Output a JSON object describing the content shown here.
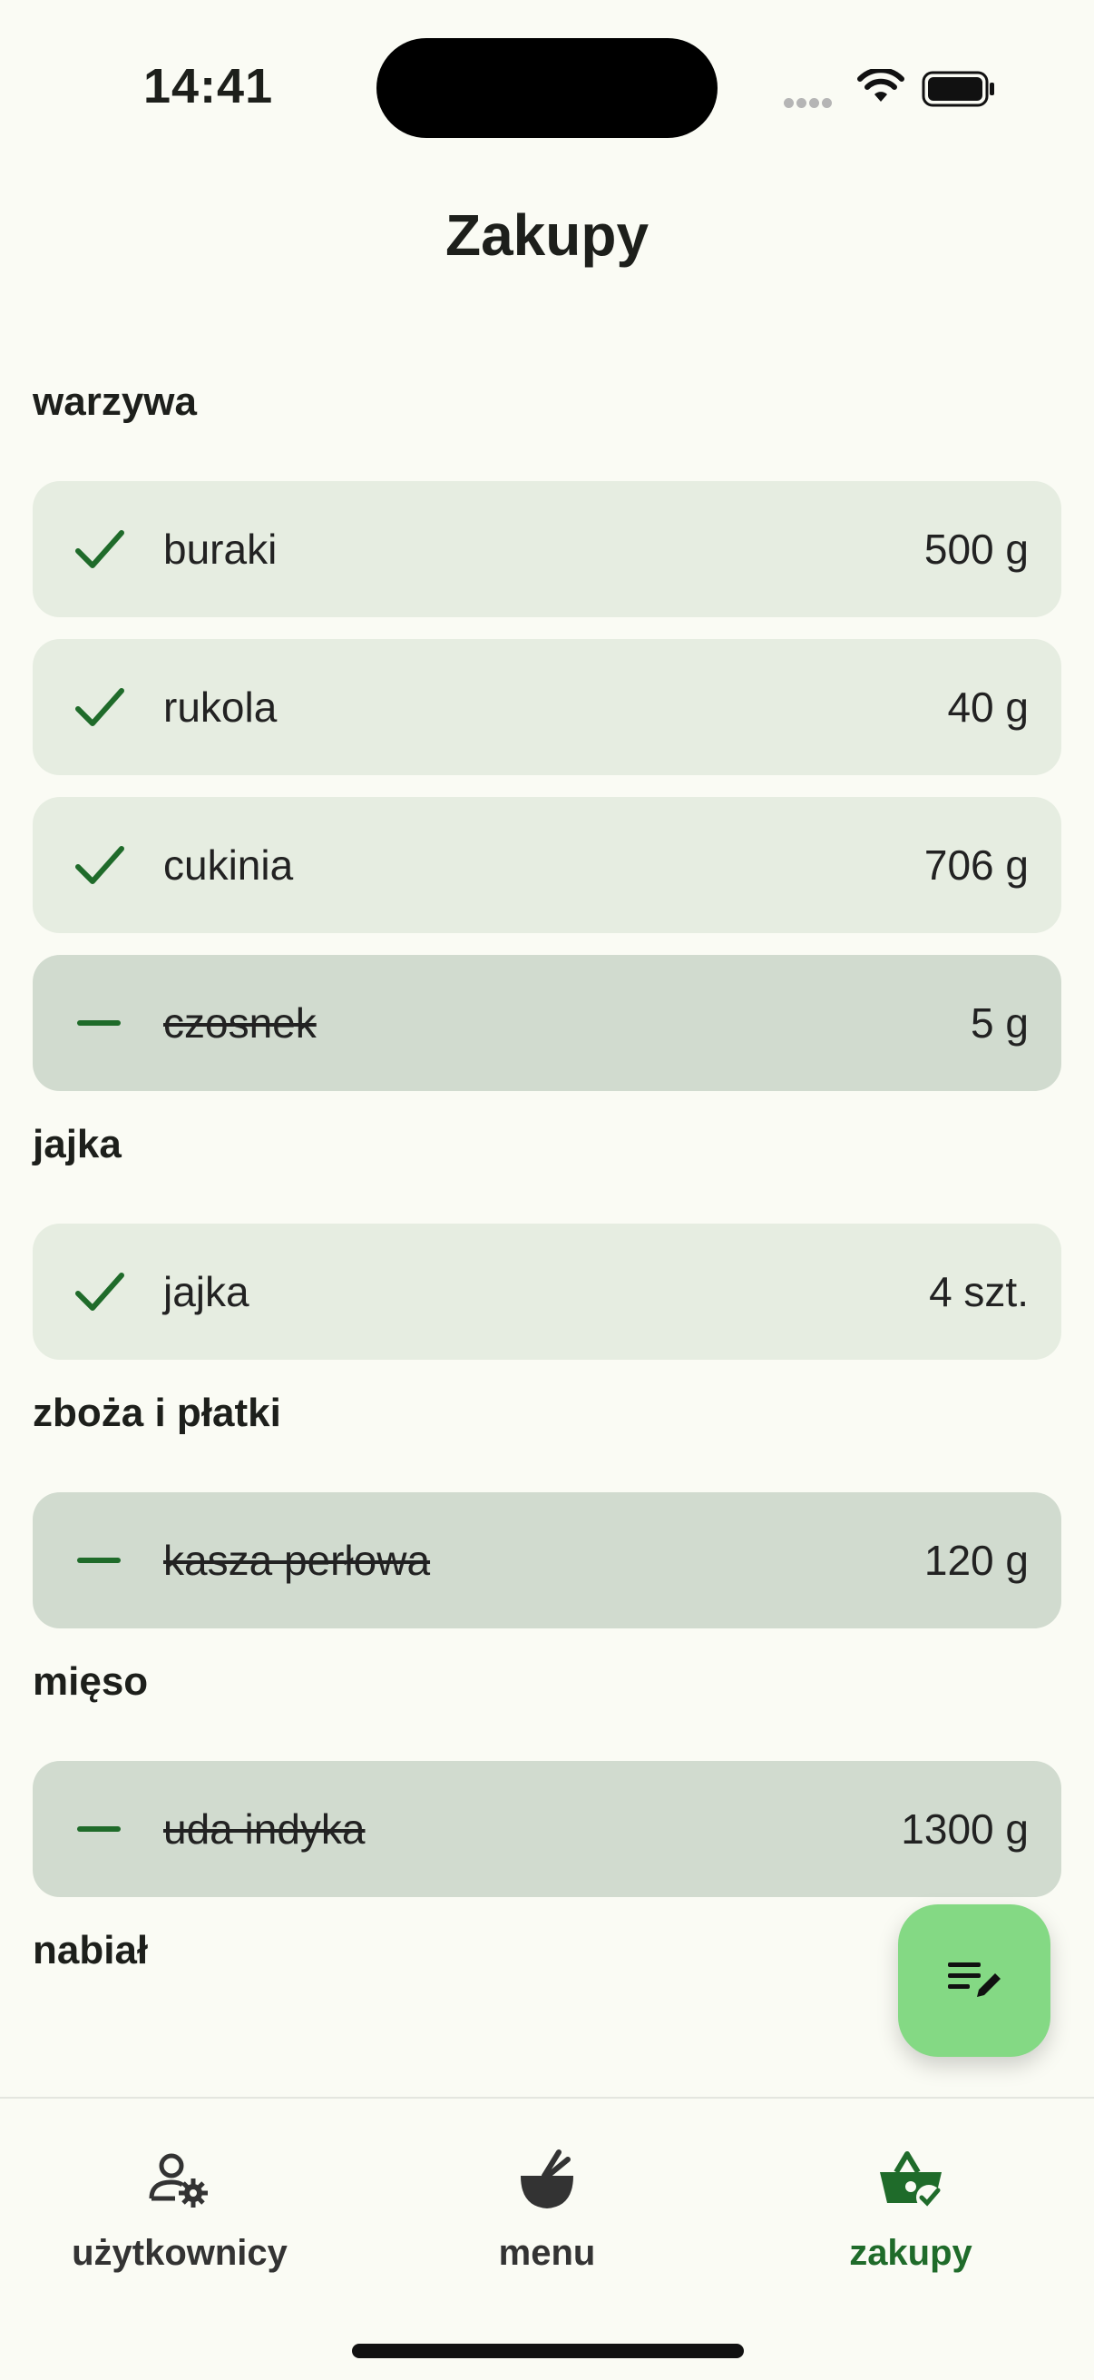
{
  "status_bar": {
    "time": "14:41"
  },
  "page_title": "Zakupy",
  "sections": [
    {
      "title": "warzywa",
      "items": [
        {
          "name": "buraki",
          "qty": "500 g",
          "checked": true
        },
        {
          "name": "rukola",
          "qty": "40 g",
          "checked": true
        },
        {
          "name": "cukinia",
          "qty": "706 g",
          "checked": true
        },
        {
          "name": "czosnek",
          "qty": "5 g",
          "checked": false
        }
      ]
    },
    {
      "title": "jajka",
      "items": [
        {
          "name": "jajka",
          "qty": "4 szt.",
          "checked": true
        }
      ]
    },
    {
      "title": "zboża i płatki",
      "items": [
        {
          "name": "kasza perłowa",
          "qty": "120 g",
          "checked": false
        }
      ]
    },
    {
      "title": "mięso",
      "items": [
        {
          "name": "uda indyka",
          "qty": "1300 g",
          "checked": false
        }
      ]
    },
    {
      "title": "nabiał",
      "items": []
    }
  ],
  "bottom_nav": [
    {
      "label": "użytkownicy",
      "icon": "users-settings-icon",
      "active": false
    },
    {
      "label": "menu",
      "icon": "bowl-icon",
      "active": false
    },
    {
      "label": "zakupy",
      "icon": "basket-check-icon",
      "active": true
    }
  ],
  "colors": {
    "accent": "#1f6b2a",
    "fab": "#84d984",
    "item_checked_bg": "#e6ede1",
    "item_unchecked_bg": "#d1dbcf",
    "background": "#fafbf4"
  }
}
